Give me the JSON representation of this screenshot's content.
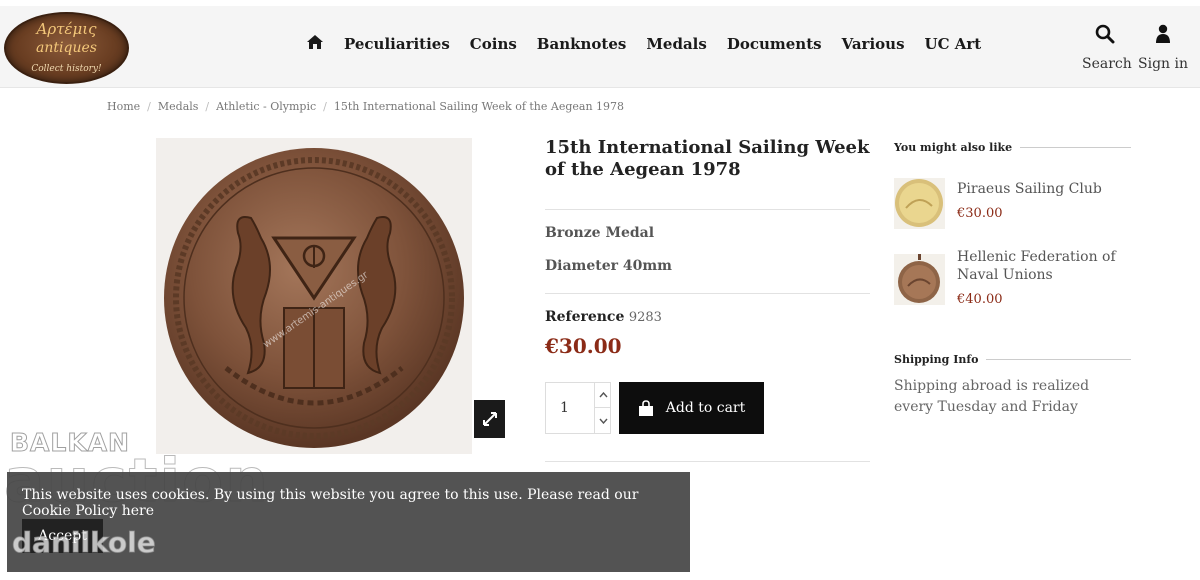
{
  "logo": {
    "line1": "Αρτέμις",
    "line2": "antiques",
    "line3": "Collect history!"
  },
  "nav": {
    "items": [
      "Peculiarities",
      "Coins",
      "Banknotes",
      "Medals",
      "Documents",
      "Various",
      "UC Art"
    ],
    "search_label": "Search",
    "signin_label": "Sign in"
  },
  "breadcrumb": [
    "Home",
    "Medals",
    "Athletic - Olympic",
    "15th International Sailing Week of the Aegean 1978"
  ],
  "product": {
    "title": "15th International Sailing Week of the Aegean 1978",
    "attr1": "Bronze Medal",
    "attr2": "Diameter 40mm",
    "reference_label": "Reference",
    "reference_value": "9283",
    "price": "€30.00",
    "quantity": "1",
    "add_to_cart": "Add to cart",
    "image_watermark": "www.artemis-antiques.gr"
  },
  "sidebar": {
    "also_like_title": "You might also like",
    "related": [
      {
        "name": "Piraeus Sailing Club",
        "price": "€30.00"
      },
      {
        "name": "Hellenic Federation of Naval Unions",
        "price": "€40.00"
      }
    ],
    "shipping_title": "Shipping Info",
    "shipping_text": "Shipping abroad is realized every Tuesday and Friday"
  },
  "watermark": {
    "line1": "BALKAN",
    "line2": "auction",
    "line3": "danilkole"
  },
  "cookie": {
    "text": "This website uses cookies. By using this website you agree to this use. Please read our Cookie Policy here",
    "accept": "Accept"
  },
  "colors": {
    "price": "#8b2b17",
    "button": "#0d0d0d",
    "cookie_bg": "#464646"
  }
}
